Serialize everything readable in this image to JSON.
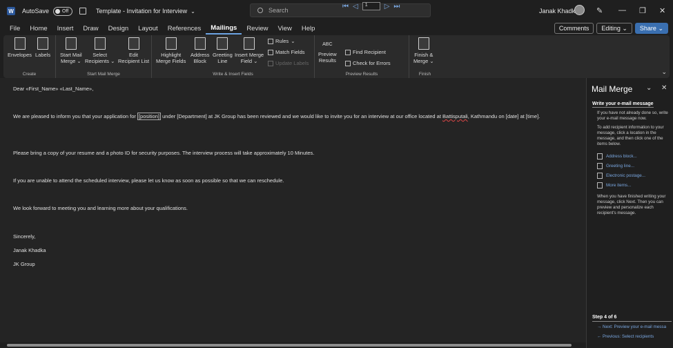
{
  "titlebar": {
    "autosave_label": "AutoSave",
    "autosave_state": "Off",
    "doc_title": "Template - Invitation for Interview",
    "search_placeholder": "Search",
    "user_name": "Janak Khadka"
  },
  "menu": {
    "tabs": [
      "File",
      "Home",
      "Insert",
      "Draw",
      "Design",
      "Layout",
      "References",
      "Mailings",
      "Review",
      "View",
      "Help"
    ],
    "active": "Mailings",
    "comments": "Comments",
    "editing": "Editing",
    "share": "Share"
  },
  "ribbon": {
    "create": {
      "label": "Create",
      "envelopes": "Envelopes",
      "labels": "Labels"
    },
    "start": {
      "label": "Start Mail Merge",
      "start_btn": [
        "Start Mail",
        "Merge"
      ],
      "select_btn": [
        "Select",
        "Recipients"
      ],
      "edit_btn": [
        "Edit",
        "Recipient List"
      ]
    },
    "write": {
      "label": "Write & Insert Fields",
      "highlight": [
        "Highlight",
        "Merge Fields"
      ],
      "address": [
        "Address",
        "Block"
      ],
      "greeting": [
        "Greeting",
        "Line"
      ],
      "insert_field": [
        "Insert Merge",
        "Field"
      ],
      "rules": "Rules",
      "match": "Match Fields",
      "update": "Update Labels"
    },
    "preview": {
      "label": "Preview Results",
      "preview_btn": [
        "Preview",
        "Results"
      ],
      "abc": "ABC",
      "record": "1",
      "find": "Find Recipient",
      "check": "Check for Errors"
    },
    "finish": {
      "label": "Finish",
      "finish_btn": [
        "Finish &",
        "Merge"
      ]
    }
  },
  "document": {
    "greeting": "Dear «First_Name» «Last_Name»,",
    "p1_a": "We are pleased to inform you that your application for ",
    "p1_pos": "[position]",
    "p1_b": " under [Department] at JK Group has been reviewed and we would like to invite you for an interview at our office located at ",
    "p1_place": "Battisputali",
    "p1_c": ", Kathmandu on [date] at [time].",
    "p2": "Please bring a copy of your resume and a photo ID for security purposes. The interview process will take approximately 10 Minutes.",
    "p3": "If you are unable to attend the scheduled interview, please let us know as soon as possible so that we can reschedule.",
    "p4": "We look forward to meeting you and learning more about your qualifications.",
    "closing": "Sincerely,",
    "sig_name": "Janak Khadka",
    "sig_org": "JK Group"
  },
  "pane": {
    "title": "Mail Merge",
    "subtitle": "Write your e-mail message",
    "intro": "If you have not already done so, write your e-mail message now.",
    "instr": "To add recipient information to your message, click a location in the message, and then click one of the items below.",
    "links": [
      "Address block...",
      "Greeting line...",
      "Electronic postage...",
      "More items..."
    ],
    "after": "When you have finished writing your message, click Next. Then you can preview and personalize each recipient's message.",
    "step": "Step 4 of 6",
    "next": "Next: Preview your e-mail messa",
    "prev": "Previous: Select recipients"
  }
}
